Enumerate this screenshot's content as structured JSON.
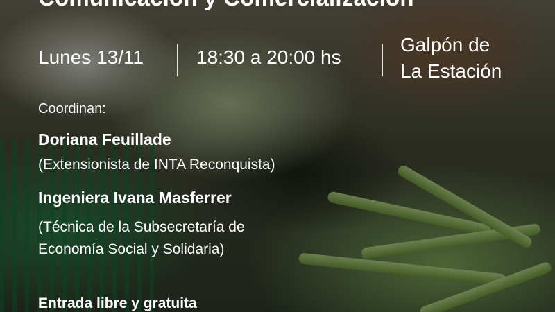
{
  "event": {
    "title": "Comunicación y Comercialización",
    "date": "Lunes 13/11",
    "time": "18:30 a 20:00 hs",
    "place_line1": "Galpón de",
    "place_line2": "La Estación"
  },
  "coordinators": {
    "label": "Coordinan:",
    "people": [
      {
        "name": "Doriana Feuillade",
        "role_line1": "(Extensionista de INTA Reconquista)",
        "role_line2": ""
      },
      {
        "name": "Ingeniera Ivana Masferrer",
        "role_line1": "(Técnica de la Subsecretaría de",
        "role_line2": "Economía Social y Solidaria)"
      }
    ]
  },
  "footer": {
    "entry": "Entrada libre y gratuita"
  }
}
